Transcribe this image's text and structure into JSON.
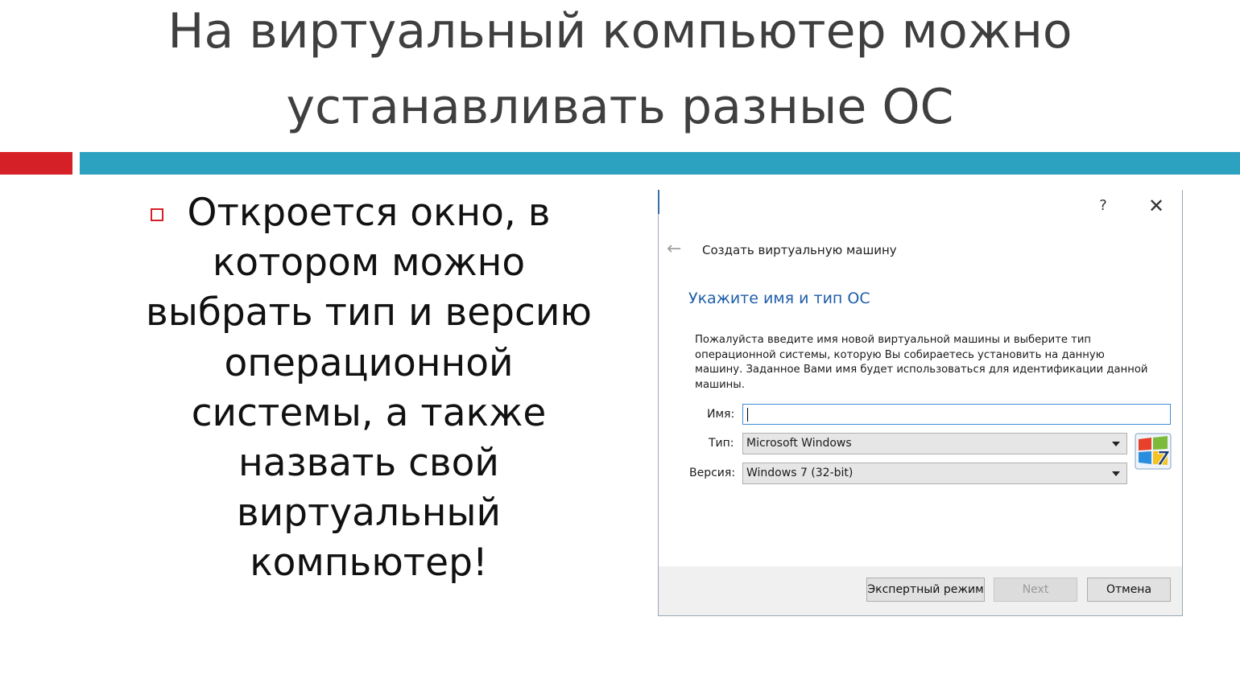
{
  "slide": {
    "title_lines": [
      "На виртуальный компьютер можно",
      "устанавливать разные ОС"
    ],
    "bullet_lines": [
      "Откроется окно, в",
      "котором можно",
      "выбрать тип и версию",
      "операционной",
      "системы, а также",
      "назвать свой",
      "виртуальный",
      "компьютер!"
    ],
    "accent_colors": {
      "red": "#d62027",
      "teal": "#2ca1c0"
    }
  },
  "dialog": {
    "help_label": "?",
    "close_label": "✕",
    "back_label": "←",
    "wizard_title": "Создать виртуальную машину",
    "heading": "Укажите имя и тип ОС",
    "description_lines": [
      "Пожалуйста введите имя новой виртуальной машины и выберите тип",
      "операционной системы, которую Вы собираетесь установить на данную",
      "машину. Заданное Вами имя будет использоваться для идентификации данной",
      "машины."
    ],
    "name_label": "Имя:",
    "name_value": "",
    "type_label": "Тип:",
    "type_value": "Microsoft Windows",
    "version_label": "Версия:",
    "version_value": "Windows 7 (32-bit)",
    "os_badge": "7",
    "buttons": {
      "expert": "Экспертный режим",
      "next": "Next",
      "cancel": "Отмена"
    },
    "accent_color": "#1f5ea8"
  }
}
